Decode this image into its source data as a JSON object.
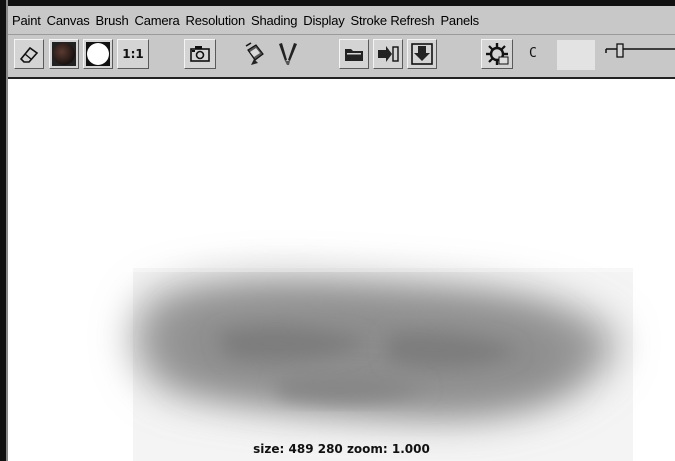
{
  "menu": [
    "Paint",
    "Canvas",
    "Brush",
    "Camera",
    "Resolution",
    "Shading",
    "Display",
    "Stroke Refresh",
    "Panels"
  ],
  "toolbar": {
    "scale_label": "1:1",
    "channel_label": "C",
    "icons": [
      "eraser-icon",
      "dark-sphere-icon",
      "white-circle-icon",
      "camera-icon",
      "paint-bucket-icon",
      "brushes-icon",
      "folder-icon",
      "import-icon",
      "save-down-arrow-icon",
      "gear-icon"
    ],
    "color_well": "#e3e3e3"
  },
  "canvas": {
    "status_text": "size:  489  280 zoom: 1.000"
  }
}
